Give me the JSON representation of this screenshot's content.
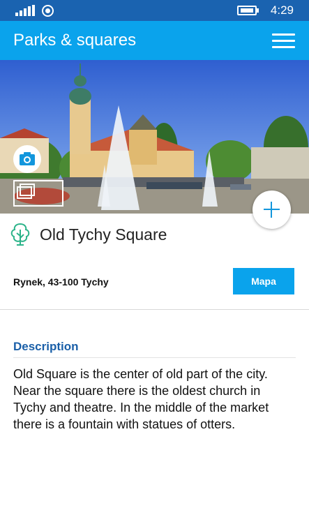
{
  "status": {
    "time": "4:29"
  },
  "app": {
    "title": "Parks & squares"
  },
  "place": {
    "name": "Old Tychy Square",
    "address": "Rynek, 43-100 Tychy",
    "map_label": "Mapa"
  },
  "description": {
    "heading": "Description",
    "text": "Old Square is the center of old part of the city. Near the square there is the oldest church in Tychy and theatre. In the middle of the market there is a fountain with statues of otters."
  },
  "icons": {
    "status": [
      "signal-icon",
      "record-icon",
      "battery-icon"
    ],
    "actions": [
      "menu-icon",
      "camera-icon",
      "gallery-icon",
      "add-icon",
      "tree-icon"
    ]
  },
  "colors": {
    "status_bar": "#1a63b0",
    "app_bar": "#0aa3ec",
    "heading": "#1a5fa8",
    "map_button": "#0aa3ec",
    "add_icon": "#1396dc"
  }
}
